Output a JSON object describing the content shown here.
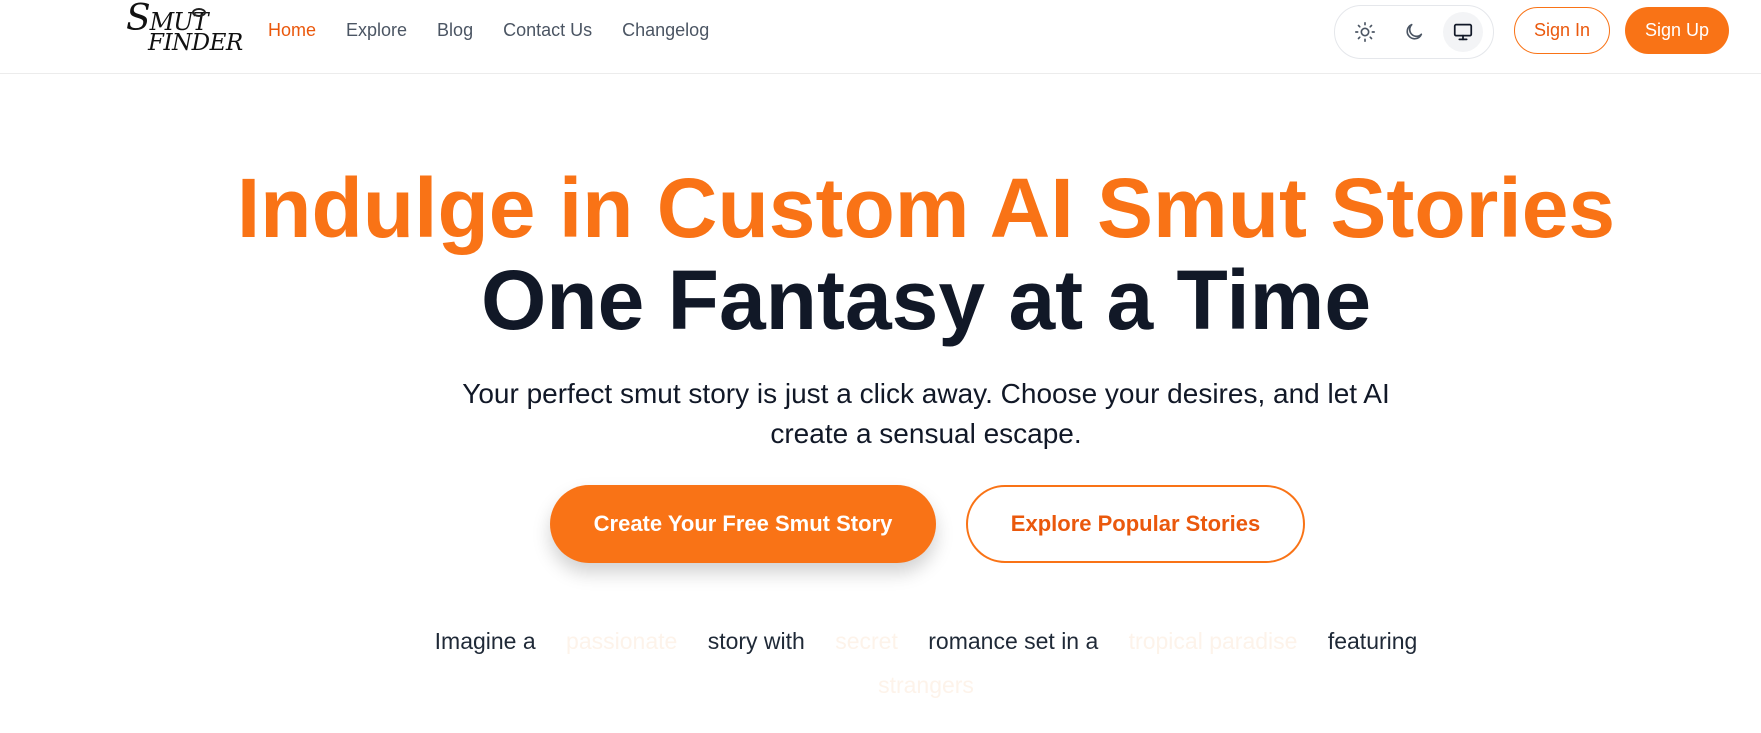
{
  "brand": {
    "logo_line1": "SMUT",
    "logo_line2": "FINDER"
  },
  "nav": {
    "items": [
      {
        "label": "Home",
        "active": true
      },
      {
        "label": "Explore",
        "active": false
      },
      {
        "label": "Blog",
        "active": false
      },
      {
        "label": "Contact Us",
        "active": false
      },
      {
        "label": "Changelog",
        "active": false
      }
    ]
  },
  "theme": {
    "options": [
      "sun-icon",
      "moon-icon",
      "monitor-icon"
    ],
    "selected": "monitor-icon"
  },
  "auth": {
    "sign_in": "Sign In",
    "sign_up": "Sign Up"
  },
  "hero": {
    "headline_accent": "Indulge in Custom AI Smut Stories",
    "headline_main": "One Fantasy at a Time",
    "subtitle": "Your perfect smut story is just a click away. Choose your desires, and let AI create a sensual escape.",
    "cta_primary": "Create Your Free Smut Story",
    "cta_secondary": "Explore Popular Stories"
  },
  "imagine": {
    "prefix": "Imagine a",
    "slot1": "passionate",
    "mid1": "story with",
    "slot2": "secret",
    "mid2": "romance set in a",
    "slot3": "tropical paradise",
    "suffix": "featuring",
    "slot4": "strangers"
  },
  "colors": {
    "accent": "#f97316",
    "accent_dark": "#ea580c",
    "text_dark": "#111827",
    "nav_text": "#4b5563"
  }
}
